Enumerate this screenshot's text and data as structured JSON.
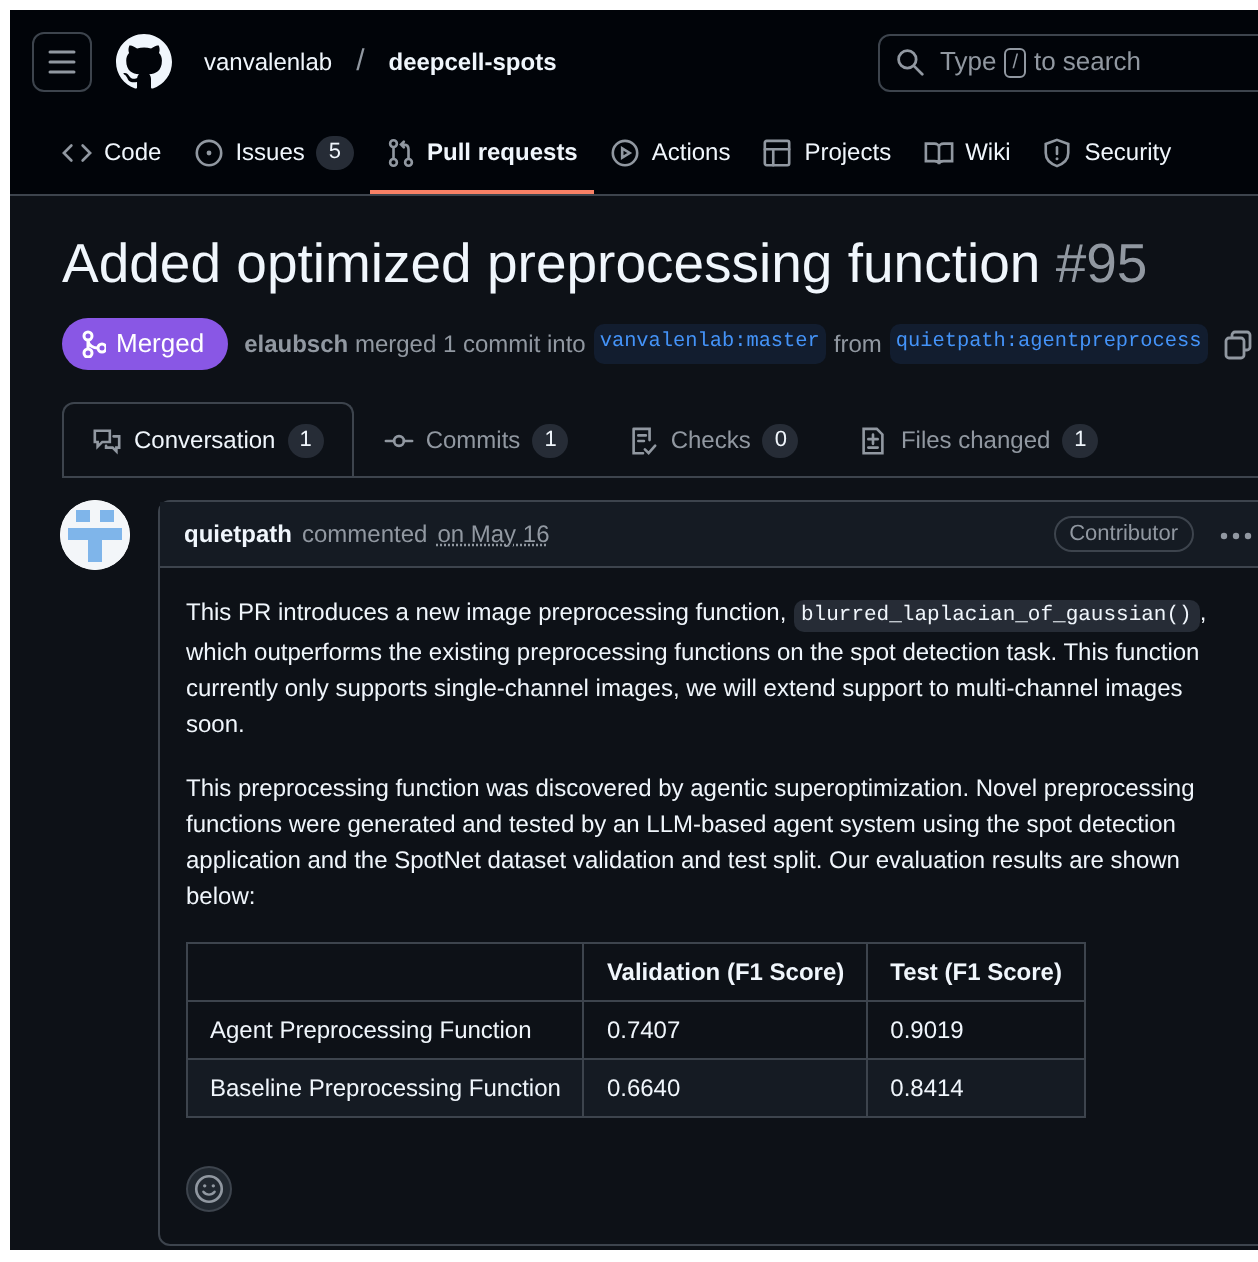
{
  "repo": {
    "owner": "vanvalenlab",
    "separator": "/",
    "name": "deepcell-spots"
  },
  "search": {
    "prefix": "Type",
    "key": "/",
    "suffix": "to search"
  },
  "repo_tabs": [
    {
      "label": "Code",
      "selected": false
    },
    {
      "label": "Issues",
      "count": "5",
      "selected": false
    },
    {
      "label": "Pull requests",
      "selected": true
    },
    {
      "label": "Actions",
      "selected": false
    },
    {
      "label": "Projects",
      "selected": false
    },
    {
      "label": "Wiki",
      "selected": false
    },
    {
      "label": "Security",
      "selected": false
    }
  ],
  "pull_request": {
    "title": "Added optimized preprocessing function",
    "number": "#95",
    "state": "Merged",
    "author": "elaubsch",
    "summary": "merged 1 commit into",
    "base": "vanvalenlab:master",
    "from": "from",
    "head": "quietpath:agentpreprocess"
  },
  "pr_tabs": [
    {
      "label": "Conversation",
      "count": "1",
      "selected": true
    },
    {
      "label": "Commits",
      "count": "1",
      "selected": false
    },
    {
      "label": "Checks",
      "count": "0",
      "selected": false
    },
    {
      "label": "Files changed",
      "count": "1",
      "selected": false
    }
  ],
  "comment": {
    "author": "quietpath",
    "action": "commented",
    "date": "on May 16",
    "role": "Contributor",
    "paragraphs": [
      [
        {
          "kind": "text",
          "text": "This PR introduces a new image preprocessing function, "
        },
        {
          "kind": "code",
          "text": "blurred_laplacian_of_gaussian()"
        },
        {
          "kind": "text",
          "text": ", which outperforms the existing preprocessing functions on the spot detection task. This function currently only supports single-channel images, we will extend support to multi-channel images soon."
        }
      ],
      [
        {
          "kind": "text",
          "text": "This preprocessing function was discovered by agentic superoptimization. Novel preprocessing functions were generated and tested by an LLM-based agent system using the spot detection application and the SpotNet dataset validation and test split. Our evaluation results are shown below:"
        }
      ]
    ],
    "table": {
      "columns": [
        "",
        "Validation (F1 Score)",
        "Test (F1 Score)"
      ],
      "rows": [
        [
          "Agent Preprocessing Function",
          "0.7407",
          "0.9019"
        ],
        [
          "Baseline Preprocessing Function",
          "0.6640",
          "0.8414"
        ]
      ]
    }
  }
}
